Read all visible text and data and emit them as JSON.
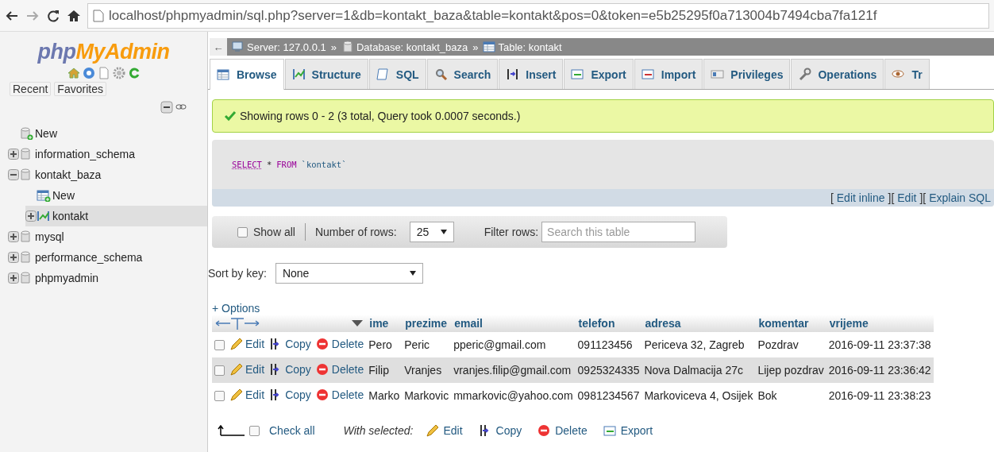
{
  "browser": {
    "url": "localhost/phpmyadmin/sql.php?server=1&db=kontakt_baza&table=kontakt&pos=0&token=e5b25295f0a713004b7494cba7fa121f"
  },
  "sidebar": {
    "logo_left": "php",
    "logo_right": "MyAdmin",
    "buttons": [
      "Recent",
      "Favorites"
    ],
    "tree": [
      {
        "kind": "new",
        "label": "New",
        "selected": false
      },
      {
        "kind": "database",
        "label": "information_schema",
        "expanded": false,
        "selected": false
      },
      {
        "kind": "database",
        "label": "kontakt_baza",
        "expanded": true,
        "selected": false,
        "children": [
          {
            "kind": "new_table",
            "label": "New",
            "selected": false
          },
          {
            "kind": "table",
            "label": "kontakt",
            "expanded": false,
            "selected": true
          }
        ]
      },
      {
        "kind": "database",
        "label": "mysql",
        "expanded": false,
        "selected": false
      },
      {
        "kind": "database",
        "label": "performance_schema",
        "expanded": false,
        "selected": false
      },
      {
        "kind": "database",
        "label": "phpmyadmin",
        "expanded": false,
        "selected": false
      }
    ]
  },
  "collapse_button": "←",
  "breadcrumb": [
    {
      "kind": "server",
      "label": "Server: 127.0.0.1"
    },
    {
      "kind": "database",
      "label": "Database: kontakt_baza"
    },
    {
      "kind": "table",
      "label": "Table: kontakt"
    }
  ],
  "breadcrumb_separator": "»",
  "tabs": [
    {
      "kind": "browse",
      "label": "Browse",
      "selected": true
    },
    {
      "kind": "structure",
      "label": "Structure",
      "selected": false
    },
    {
      "kind": "sql",
      "label": "SQL",
      "selected": false
    },
    {
      "kind": "search",
      "label": "Search",
      "selected": false
    },
    {
      "kind": "insert",
      "label": "Insert",
      "selected": false
    },
    {
      "kind": "export",
      "label": "Export",
      "selected": false
    },
    {
      "kind": "import",
      "label": "Import",
      "selected": false
    },
    {
      "kind": "privileges",
      "label": "Privileges",
      "selected": false
    },
    {
      "kind": "operations",
      "label": "Operations",
      "selected": false
    },
    {
      "kind": "tracking",
      "label": "Tr",
      "selected": false
    }
  ],
  "message": "Showing rows 0 - 2 (3 total, Query took 0.0007 seconds.)",
  "query": {
    "keyword1": "SELECT",
    "star": "*",
    "keyword2": "FROM",
    "table": "`kontakt`",
    "links": [
      {
        "open": "[",
        "label": "Edit inline",
        "close": "]"
      },
      {
        "open": "[",
        "label": "Edit",
        "close": "]"
      },
      {
        "open": "[",
        "label": "Explain SQL"
      }
    ]
  },
  "navigation": {
    "show_all_label": "Show all",
    "show_all_checked": false,
    "rows_label": "Number of rows:",
    "rows_value": "25",
    "filter_label": "Filter rows:",
    "filter_placeholder": "Search this table"
  },
  "sort": {
    "label": "Sort by key:",
    "value": "None"
  },
  "options_link": "+ Options",
  "table": {
    "columns": [
      "ime",
      "prezime",
      "email",
      "telefon",
      "adresa",
      "komentar",
      "vrijeme"
    ],
    "rows": [
      {
        "checked": false,
        "actions": [
          "Edit",
          "Copy",
          "Delete"
        ],
        "cells": [
          "Pero",
          "Peric",
          "pperic@gmail.com",
          "091123456",
          "Periceva 32, Zagreb",
          "Pozdrav",
          "2016-09-11 23:37:38"
        ]
      },
      {
        "checked": false,
        "actions": [
          "Edit",
          "Copy",
          "Delete"
        ],
        "cells": [
          "Filip",
          "Vranjes",
          "vranjes.filip@gmail.com",
          "0925324335",
          "Nova Dalmacija 27c",
          "Lijep pozdrav",
          "2016-09-11 23:36:42"
        ]
      },
      {
        "checked": false,
        "actions": [
          "Edit",
          "Copy",
          "Delete"
        ],
        "cells": [
          "Marko",
          "Markovic",
          "mmarkovic@yahoo.com",
          "0981234567",
          "Markoviceva 4, Osijek",
          "Bok",
          "2016-09-11 23:38:23"
        ]
      }
    ]
  },
  "footer": {
    "check_all_label": "Check all",
    "check_all_checked": false,
    "with_selected": "With selected:",
    "actions": [
      {
        "kind": "edit",
        "label": "Edit"
      },
      {
        "kind": "copy",
        "label": "Copy"
      },
      {
        "kind": "delete",
        "label": "Delete"
      },
      {
        "kind": "export",
        "label": "Export"
      }
    ]
  }
}
